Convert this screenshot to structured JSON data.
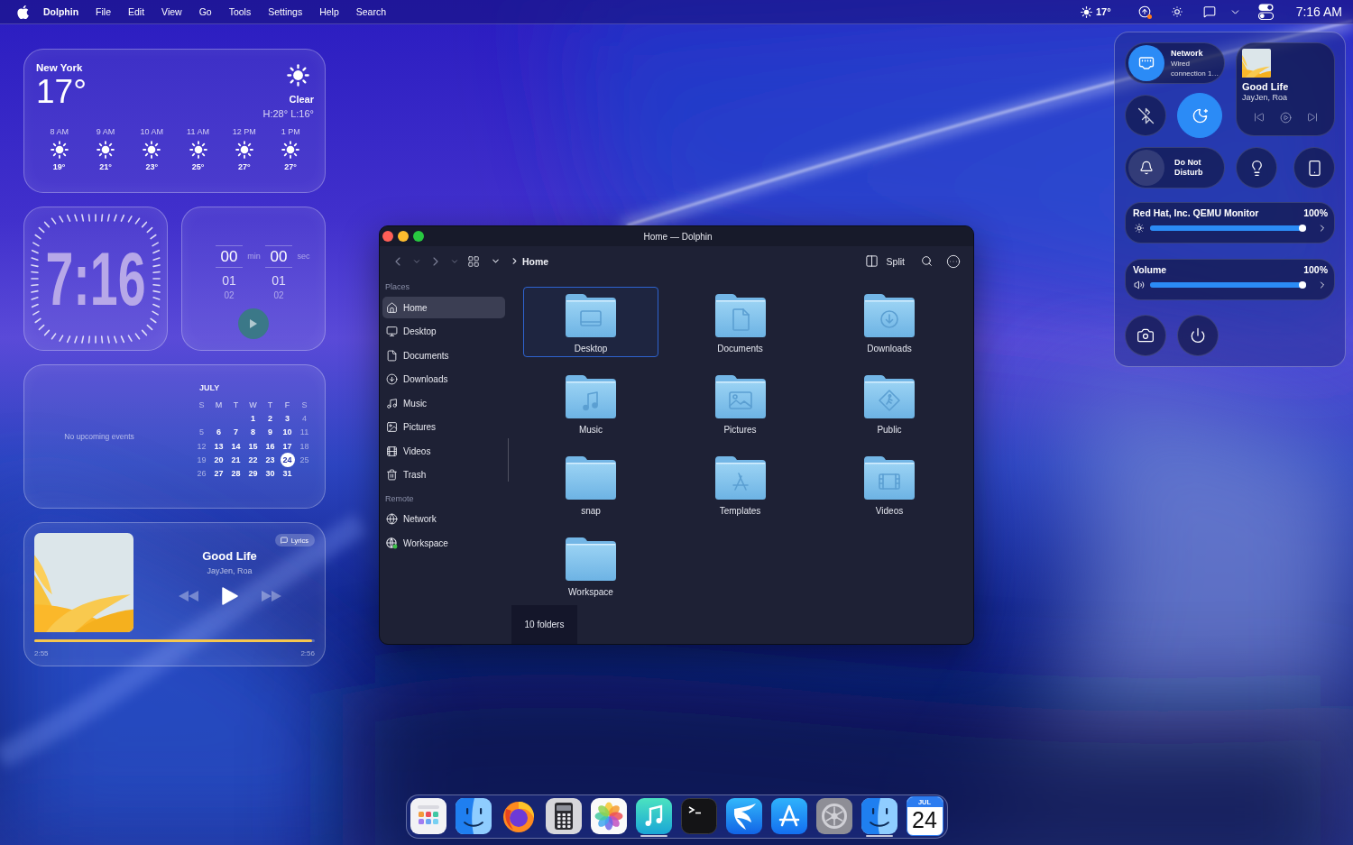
{
  "menu_bar": {
    "app_name": "Dolphin",
    "menus": [
      "File",
      "Edit",
      "View",
      "Go",
      "Tools",
      "Settings",
      "Help",
      "Search"
    ],
    "weather": "17°",
    "update_available": true,
    "clock": "7:16 AM"
  },
  "weather_widget": {
    "city": "New York",
    "temperature": "17°",
    "condition": "Clear",
    "high_low": "H:28° L:16°",
    "hourly": [
      {
        "time": "8 AM",
        "temperature": "19°"
      },
      {
        "time": "9 AM",
        "temperature": "21°"
      },
      {
        "time": "10 AM",
        "temperature": "23°"
      },
      {
        "time": "11 AM",
        "temperature": "25°"
      },
      {
        "time": "12 PM",
        "temperature": "27°"
      },
      {
        "time": "1 PM",
        "temperature": "27°"
      }
    ]
  },
  "clock_widget": {
    "time": "7:16"
  },
  "timer_widget": {
    "fields": [
      {
        "value": "00",
        "unit": "min",
        "next": "01",
        "after": "02"
      },
      {
        "value": "00",
        "unit": "sec",
        "next": "01",
        "after": "02"
      }
    ],
    "running": false
  },
  "calendar_widget": {
    "empty_message": "No upcoming events",
    "month": "JULY",
    "weekdays": [
      "S",
      "M",
      "T",
      "W",
      "T",
      "F",
      "S"
    ],
    "weeks": [
      [
        {
          "day": "1",
          "selected": false
        },
        {
          "day": "2",
          "selected": false
        },
        {
          "day": "3",
          "selected": false
        },
        {
          "day": "4",
          "selected": false
        }
      ],
      [
        {
          "day": "5",
          "selected": false
        },
        {
          "day": "6",
          "selected": false
        },
        {
          "day": "7",
          "selected": false
        },
        {
          "day": "8",
          "selected": false
        },
        {
          "day": "9",
          "selected": false
        },
        {
          "day": "10",
          "selected": false
        },
        {
          "day": "11",
          "selected": false
        }
      ],
      [
        {
          "day": "12",
          "selected": false
        },
        {
          "day": "13",
          "selected": false
        },
        {
          "day": "14",
          "selected": false
        },
        {
          "day": "15",
          "selected": false
        },
        {
          "day": "16",
          "selected": false
        },
        {
          "day": "17",
          "selected": false
        },
        {
          "day": "18",
          "selected": false
        }
      ],
      [
        {
          "day": "19",
          "selected": false
        },
        {
          "day": "20",
          "selected": false
        },
        {
          "day": "21",
          "selected": false
        },
        {
          "day": "22",
          "selected": false
        },
        {
          "day": "23",
          "selected": false
        },
        {
          "day": "24",
          "selected": true
        },
        {
          "day": "25",
          "selected": false
        }
      ],
      [
        {
          "day": "26",
          "selected": false
        },
        {
          "day": "27",
          "selected": false
        },
        {
          "day": "28",
          "selected": false
        },
        {
          "day": "29",
          "selected": false
        },
        {
          "day": "30",
          "selected": false
        },
        {
          "day": "31",
          "selected": false
        }
      ]
    ]
  },
  "music_widget": {
    "lyrics_label": "Lyrics",
    "title": "Good Life",
    "artist": "JayJen, Roa",
    "playing": false,
    "progress": {
      "level": 0.99,
      "elapsed": "2:55",
      "duration": "2:56"
    }
  },
  "dolphin_window": {
    "title": "Home — Dolphin",
    "breadcrumb": "Home",
    "split_label": "Split",
    "sidebar": [
      {
        "heading": "Places",
        "items": [
          {
            "label": "Home",
            "kind": "home",
            "selected": true
          },
          {
            "label": "Desktop",
            "kind": "desktop",
            "selected": false
          },
          {
            "label": "Documents",
            "kind": "documents",
            "selected": false
          },
          {
            "label": "Downloads",
            "kind": "downloads",
            "selected": false
          },
          {
            "label": "Music",
            "kind": "music",
            "selected": false
          },
          {
            "label": "Pictures",
            "kind": "pictures",
            "selected": false
          },
          {
            "label": "Videos",
            "kind": "videos",
            "selected": false
          },
          {
            "label": "Trash",
            "kind": "trash",
            "selected": false
          }
        ]
      },
      {
        "heading": "Remote",
        "items": [
          {
            "label": "Network",
            "kind": "network",
            "selected": false
          },
          {
            "label": "Workspace",
            "kind": "workspace",
            "selected": false
          }
        ]
      }
    ],
    "files": [
      {
        "name": "Desktop",
        "kind": "desktop",
        "selected": true
      },
      {
        "name": "Documents",
        "kind": "documents",
        "selected": false
      },
      {
        "name": "Downloads",
        "kind": "downloads",
        "selected": false
      },
      {
        "name": "Music",
        "kind": "music",
        "selected": false
      },
      {
        "name": "Pictures",
        "kind": "pictures",
        "selected": false
      },
      {
        "name": "Public",
        "kind": "public",
        "selected": false
      },
      {
        "name": "snap",
        "kind": "plain",
        "selected": false
      },
      {
        "name": "Templates",
        "kind": "templates",
        "selected": false
      },
      {
        "name": "Videos",
        "kind": "videos",
        "selected": false
      },
      {
        "name": "Workspace",
        "kind": "plain",
        "selected": false
      }
    ],
    "status": "10 folders"
  },
  "control_center": {
    "network": {
      "title": "Network",
      "detail": "Wired connection 1…",
      "on": true
    },
    "media": {
      "title": "Good Life",
      "artist": "JayJen, Roa",
      "playing": false
    },
    "toggles": [
      {
        "kind": "bluetooth",
        "on": false
      },
      {
        "kind": "night_light",
        "on": true
      }
    ],
    "do_not_disturb": {
      "label": "Do Not Disturb",
      "on": false
    },
    "sliders": [
      {
        "kind": "brightness",
        "label": "Red Hat, Inc. QEMU Monitor",
        "reading": "100%",
        "level": 1
      },
      {
        "kind": "volume",
        "label": "Volume",
        "reading": "100%",
        "level": 1
      }
    ]
  },
  "dock": {
    "apps": [
      {
        "kind": "launcher",
        "running": false
      },
      {
        "kind": "face",
        "running": false
      },
      {
        "kind": "fox",
        "running": false
      },
      {
        "kind": "calculator",
        "running": false
      },
      {
        "kind": "flower",
        "running": false
      },
      {
        "kind": "music",
        "running": true
      },
      {
        "kind": "terminal",
        "running": false
      },
      {
        "kind": "bird",
        "running": false
      },
      {
        "kind": "store",
        "running": false
      },
      {
        "kind": "settings",
        "running": false
      },
      {
        "kind": "face",
        "running": true
      },
      {
        "kind": "calendar",
        "running": false,
        "month": "JUL",
        "day": "24"
      }
    ]
  }
}
